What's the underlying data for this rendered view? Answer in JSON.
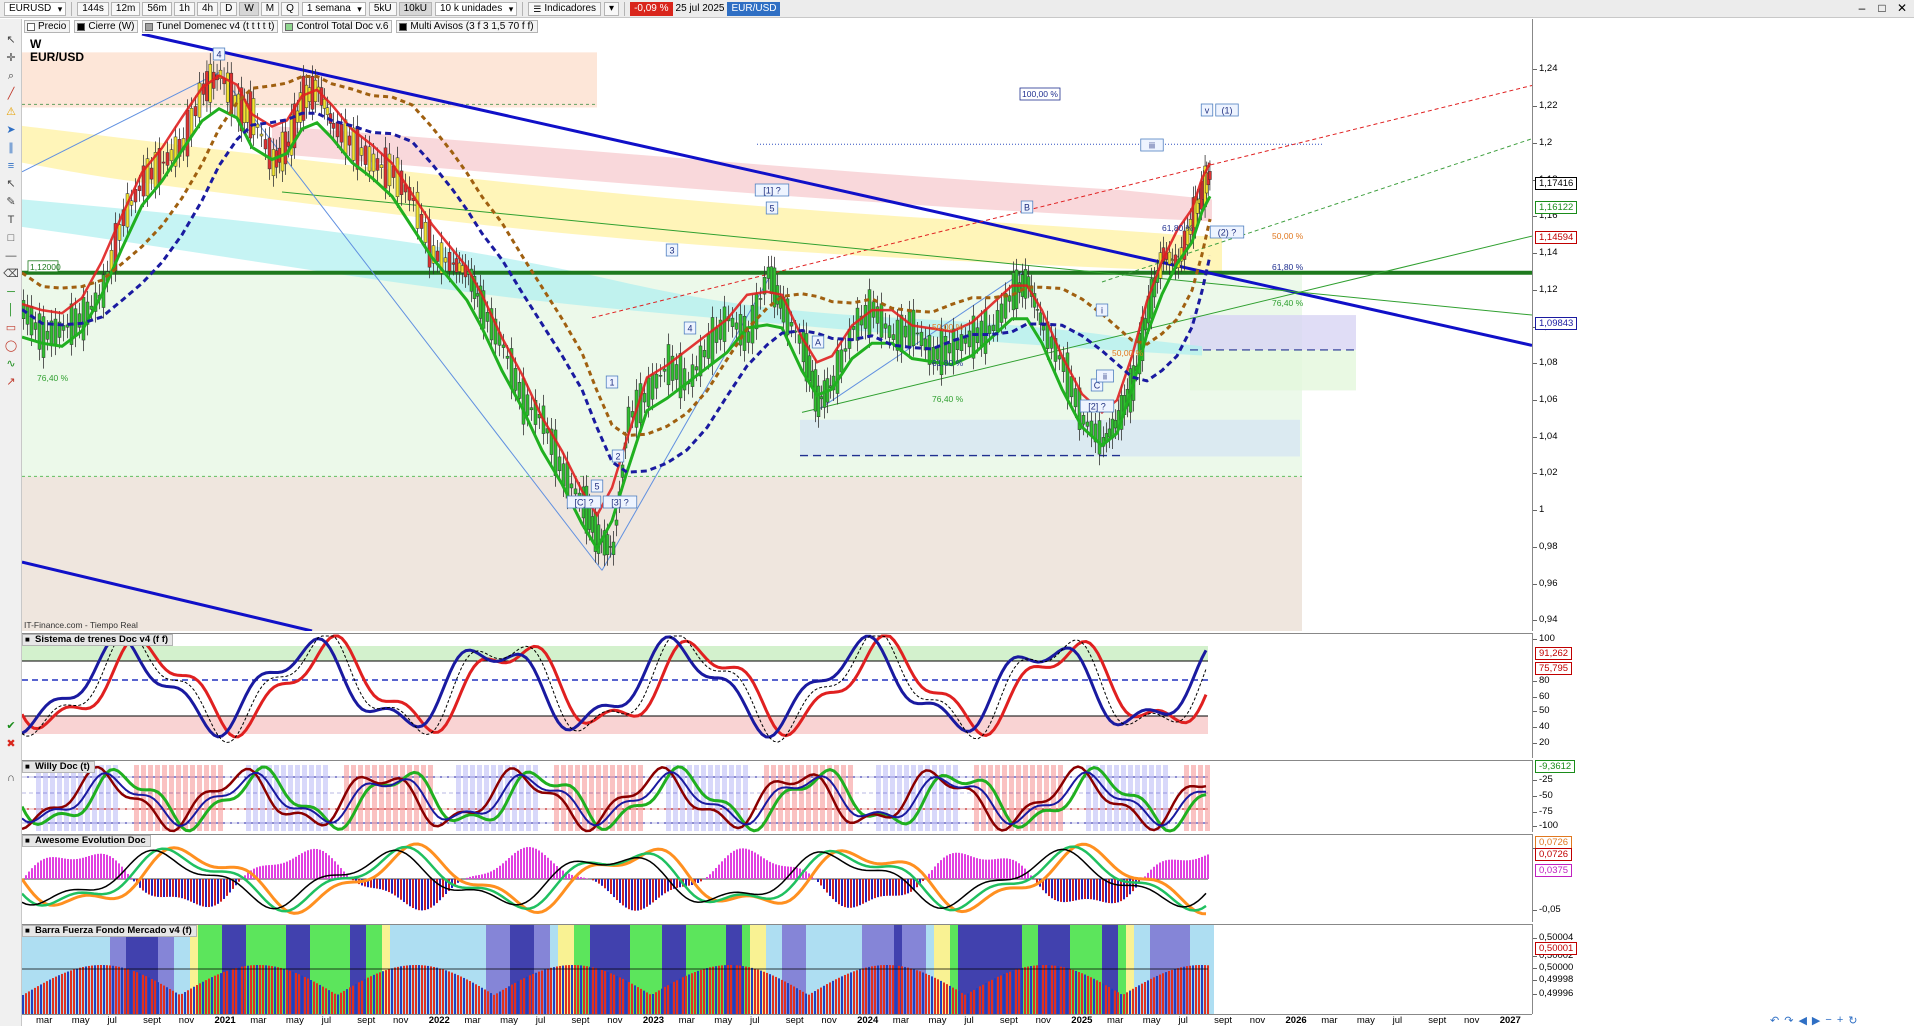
{
  "toolbar": {
    "symbol": "EURUSD",
    "timeframes": [
      "144s",
      "12m",
      "56m",
      "1h",
      "4h",
      "D",
      "W",
      "M",
      "Q"
    ],
    "active_timeframe": "W",
    "period": "1 semana",
    "units": [
      "5kU",
      "10kU"
    ],
    "active_unit": "10kU",
    "units_select": "10 k unidades",
    "indicators_label": "Indicadores",
    "change": "-0,09 %",
    "date": "25 jul 2025",
    "instrument": "EUR/USD"
  },
  "indicator_bar": {
    "items": [
      {
        "label": "Precio",
        "color": "#ffffff"
      },
      {
        "label": "Cierre (W)",
        "color": "#000000"
      },
      {
        "label": "Tunel Domenec v4 (t t t t t)",
        "color": "#a0a0a0"
      },
      {
        "label": "Control Total Doc v.6",
        "color": "#8fd68f"
      },
      {
        "label": "Multi Avisos (3 f 3 1,5 70 f f)",
        "color": "#000000"
      }
    ]
  },
  "main_chart": {
    "timeframe_label": "W",
    "pair_label": "EUR/USD",
    "source_label": "IT-Finance.com - Tiempo Real",
    "level_box": "1,12000",
    "y_ticks": [
      "1,24",
      "1,22",
      "1,2",
      "1,18",
      "1,16",
      "1,14",
      "1,12",
      "1,1",
      "1,08",
      "1,06",
      "1,04",
      "1,02",
      "1",
      "0,98",
      "0,96",
      "0,94"
    ],
    "price_badges": [
      {
        "value": "1,17416",
        "color": "#000000"
      },
      {
        "value": "1,16122",
        "color": "#1a8c1a"
      },
      {
        "value": "1,14594",
        "color": "#c00000"
      },
      {
        "value": "1,09843",
        "color": "#1a1aa0"
      }
    ],
    "wave_labels": [
      "4",
      "5",
      "[1] ?",
      "3",
      "4",
      "1",
      "2",
      "5",
      "[C] ?",
      "[3] ?",
      "A",
      "B",
      "C",
      "[2] ?",
      "i",
      "ii",
      "iii",
      "v",
      "(1)",
      "(2) ?"
    ],
    "fib_labels": [
      "100,00 %",
      "50,00 %",
      "61,80 %",
      "76,40 %",
      "50,00 %",
      "61,80 %",
      "76,40 %",
      "76,40 %",
      "61,80 %",
      "50,00 %"
    ]
  },
  "panels": {
    "trenes": {
      "title": "Sistema de trenes Doc v4 (f f)",
      "ticks": [
        "100",
        "80",
        "60",
        "50",
        "40",
        "20"
      ],
      "badges": [
        "91,262",
        "75,795"
      ]
    },
    "willy": {
      "title": "Willy Doc (t)",
      "ticks": [
        "-25",
        "-50",
        "-75",
        "-100"
      ],
      "badges": [
        "-9,3612"
      ]
    },
    "awesome": {
      "title": "Awesome Evolution Doc",
      "ticks": [
        "0,05",
        "-0,05"
      ],
      "badges": [
        "0,0726",
        "0,0726",
        "0,0375"
      ]
    },
    "barra": {
      "title": "Barra Fuerza Fondo Mercado v4 (f)",
      "ticks": [
        "0,50004",
        "0,50002",
        "0,50000",
        "0,49998",
        "0,49996"
      ],
      "badges": [
        "0,50001"
      ]
    }
  },
  "x_axis": {
    "labels": [
      "mar",
      "may",
      "jul",
      "sept",
      "nov",
      "2021",
      "mar",
      "may",
      "jul",
      "sept",
      "nov",
      "2022",
      "mar",
      "may",
      "jul",
      "sept",
      "nov",
      "2023",
      "mar",
      "may",
      "jul",
      "sept",
      "nov",
      "2024",
      "mar",
      "may",
      "jul",
      "sept",
      "nov",
      "2025",
      "mar",
      "may",
      "jul",
      "sept",
      "nov",
      "2026",
      "mar",
      "may",
      "jul",
      "sept",
      "nov",
      "2027"
    ]
  },
  "chart_data": {
    "type": "candlestick",
    "instrument": "EUR/USD",
    "interval": "W",
    "x": [
      "2020-03",
      "2020-07",
      "2020-10",
      "2021-01",
      "2021-04",
      "2021-06",
      "2021-09",
      "2021-12",
      "2022-03",
      "2022-06",
      "2022-09",
      "2022-11",
      "2023-01",
      "2023-04",
      "2023-07",
      "2023-10",
      "2023-12",
      "2024-03",
      "2024-06",
      "2024-09",
      "2024-11",
      "2025-01",
      "2025-03",
      "2025-05",
      "2025-07"
    ],
    "close": [
      1.1,
      1.14,
      1.18,
      1.22,
      1.19,
      1.21,
      1.16,
      1.13,
      1.1,
      1.05,
      0.98,
      1.03,
      1.07,
      1.09,
      1.11,
      1.06,
      1.09,
      1.08,
      1.07,
      1.11,
      1.05,
      1.03,
      1.09,
      1.13,
      1.174
    ],
    "ylim": [
      0.93,
      1.25
    ],
    "horizontal_levels": [
      1.12
    ]
  }
}
